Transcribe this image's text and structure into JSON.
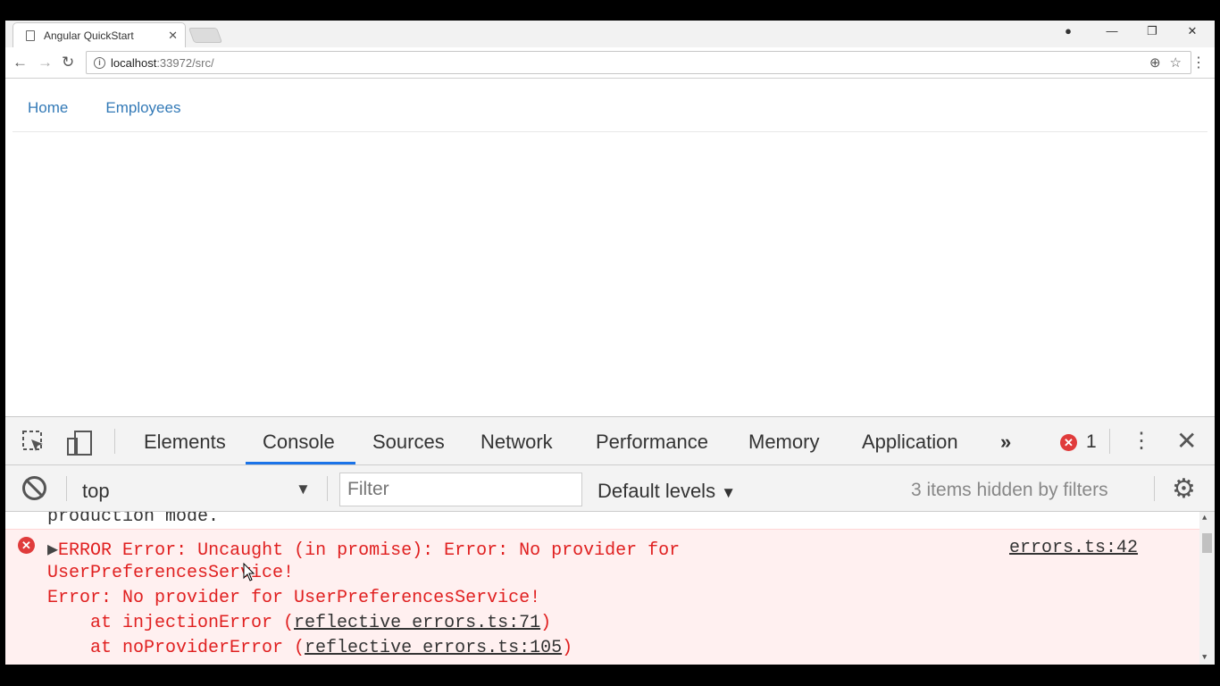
{
  "browser": {
    "tab_title": "Angular QuickStart",
    "tab_close": "✕",
    "url_host": "localhost",
    "url_rest": ":33972/src/"
  },
  "page": {
    "nav": [
      {
        "label": "Home"
      },
      {
        "label": "Employees"
      }
    ]
  },
  "devtools": {
    "tabs": [
      {
        "label": "Elements"
      },
      {
        "label": "Console"
      },
      {
        "label": "Sources"
      },
      {
        "label": "Network"
      },
      {
        "label": "Performance"
      },
      {
        "label": "Memory"
      },
      {
        "label": "Application"
      }
    ],
    "more_tabs": "»",
    "error_count": "1",
    "context": "top",
    "filter_placeholder": "Filter",
    "levels": "Default levels",
    "hidden_info": "3 items hidden by filters",
    "console": {
      "prev_line": "production mode.",
      "error": {
        "line1": "ERROR Error: Uncaught (in promise): Error: No provider for",
        "line2": "UserPreferencesService!",
        "line3": "Error: No provider for UserPreferencesService!",
        "line4_prefix": "    at injectionError (",
        "line4_link": "reflective_errors.ts:71",
        "line4_suffix": ")",
        "line5_prefix": "    at noProviderError (",
        "line5_link": "reflective_errors.ts:105",
        "line5_suffix": ")",
        "source": "errors.ts:42"
      }
    }
  },
  "colors": {
    "link_blue": "#337ab7",
    "error_red": "#e02020",
    "error_bg": "#fff0f0",
    "active_tab_underline": "#1a73e8"
  }
}
